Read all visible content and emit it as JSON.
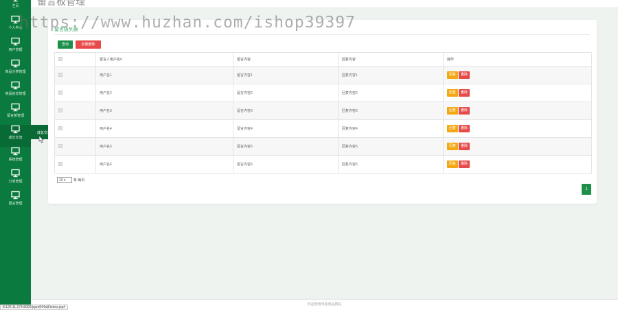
{
  "window": {
    "title": "留言板管理",
    "breadcrumb": ""
  },
  "watermark": "https://www.huzhan.com/ishop39397",
  "sidebar": {
    "items": [
      {
        "label": "主页",
        "icon": "home-icon"
      },
      {
        "label": "个人中心",
        "icon": "monitor-icon"
      },
      {
        "label": "用户管理",
        "icon": "monitor-icon"
      },
      {
        "label": "商品分类管理",
        "icon": "monitor-icon"
      },
      {
        "label": "商品信息管理",
        "icon": "monitor-icon"
      },
      {
        "label": "留言板管理",
        "icon": "monitor-icon"
      },
      {
        "label": "成长交流",
        "icon": "monitor-icon"
      },
      {
        "label": "系统管理",
        "icon": "monitor-icon"
      },
      {
        "label": "订单管理",
        "icon": "monitor-icon"
      },
      {
        "label": "留言管理",
        "icon": "monitor-icon"
      }
    ],
    "flyout": "成长交流"
  },
  "panel": {
    "title": "留言板列表"
  },
  "toolbar": {
    "search_label": "查询",
    "batch_delete_label": "批量删除"
  },
  "table": {
    "columns": [
      "",
      "留言人用户名#",
      "留言内容",
      "回复内容",
      "操作"
    ],
    "rows": [
      {
        "username": "用户名1",
        "content": "留言内容1",
        "reply": "回复内容1"
      },
      {
        "username": "用户名2",
        "content": "留言内容2",
        "reply": "回复内容2"
      },
      {
        "username": "用户名3",
        "content": "留言内容3",
        "reply": "回复内容3"
      },
      {
        "username": "用户名4",
        "content": "留言内容4",
        "reply": "回复内容4"
      },
      {
        "username": "用户名5",
        "content": "留言内容5",
        "reply": "回复内容5"
      },
      {
        "username": "用户名6",
        "content": "留言内容6",
        "reply": "回复内容6"
      }
    ],
    "reply_label": "回复",
    "delete_label": "删除"
  },
  "pager": {
    "page_size": "10",
    "page_size_suffix": "条 每页",
    "current_page": "1"
  },
  "footer": "欢迎使用母婴用品网站",
  "status_url": "8.129.11.174:8002/jspm844u8/index.jsp#",
  "colors": {
    "sidebar": "#0b7a3e",
    "primary": "#1d8f48",
    "danger": "#e84a4a",
    "warning": "#f3a712"
  }
}
